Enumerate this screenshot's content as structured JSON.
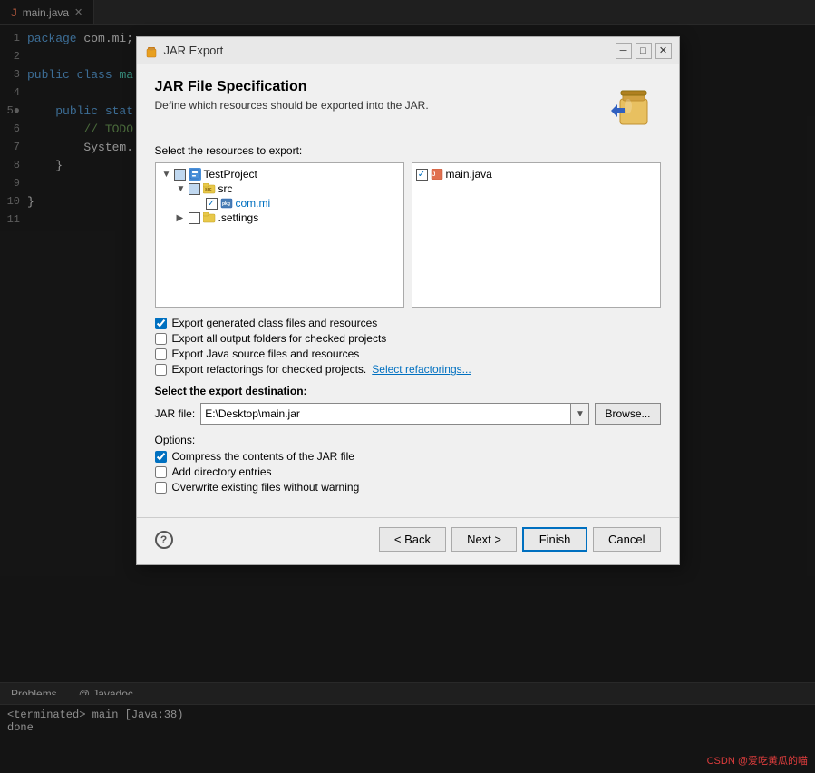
{
  "editor": {
    "tab": "main.java",
    "lines": [
      {
        "num": "1",
        "content": "package com.mi;",
        "type": "code"
      },
      {
        "num": "2",
        "content": "",
        "type": "blank"
      },
      {
        "num": "3",
        "content": "public class ma",
        "type": "code"
      },
      {
        "num": "4",
        "content": "",
        "type": "blank"
      },
      {
        "num": "5",
        "content": "    public stat",
        "type": "code"
      },
      {
        "num": "6",
        "content": "        // TODO",
        "type": "comment"
      },
      {
        "num": "7",
        "content": "        System.",
        "type": "code"
      },
      {
        "num": "8",
        "content": "    }",
        "type": "code"
      },
      {
        "num": "9",
        "content": "",
        "type": "blank"
      },
      {
        "num": "10",
        "content": "}",
        "type": "code"
      },
      {
        "num": "11",
        "content": "",
        "type": "blank"
      }
    ]
  },
  "bottomPanel": {
    "tabs": [
      "Problems",
      "@ Javadoc"
    ],
    "output": "<terminated> main [Java",
    "output2": "done",
    "timeStamp": ":38)"
  },
  "dialog": {
    "title": "JAR Export",
    "heading": "JAR File Specification",
    "description": "Define which resources should be exported into the JAR.",
    "sectionLabel": "Select the resources to export:",
    "tree": [
      {
        "level": 1,
        "label": "TestProject",
        "checked": "partial",
        "expanded": true
      },
      {
        "level": 2,
        "label": "src",
        "checked": "partial",
        "expanded": true
      },
      {
        "level": 3,
        "label": "com.mi",
        "checked": "checked",
        "highlighted": true
      },
      {
        "level": 2,
        "label": ".settings",
        "checked": "unchecked",
        "expanded": false
      }
    ],
    "filePanel": [
      {
        "label": "main.java",
        "checked": "checked"
      }
    ],
    "checkboxes": [
      {
        "label": "Export generated class files and resources",
        "checked": true,
        "id": "cb1"
      },
      {
        "label": "Export all output folders for checked projects",
        "checked": false,
        "id": "cb2"
      },
      {
        "label": "Export Java source files and resources",
        "checked": false,
        "id": "cb3"
      },
      {
        "label": "Export refactorings for checked projects.",
        "checked": false,
        "id": "cb4",
        "linkText": "Select refactorings..."
      }
    ],
    "destinationLabel": "Select the export destination:",
    "jarFileLabel": "JAR file:",
    "jarFilePath": "E:\\Desktop\\main.jar",
    "browseLabel": "Browse...",
    "optionsLabel": "Options:",
    "optionCheckboxes": [
      {
        "label": "Compress the contents of the JAR file",
        "checked": true,
        "id": "opt1"
      },
      {
        "label": "Add directory entries",
        "checked": false,
        "id": "opt2"
      },
      {
        "label": "Overwrite existing files without warning",
        "checked": false,
        "id": "opt3"
      }
    ],
    "buttons": {
      "back": "< Back",
      "next": "Next >",
      "finish": "Finish",
      "cancel": "Cancel"
    }
  },
  "watermark": "CSDN @爱吃黄瓜的喵"
}
